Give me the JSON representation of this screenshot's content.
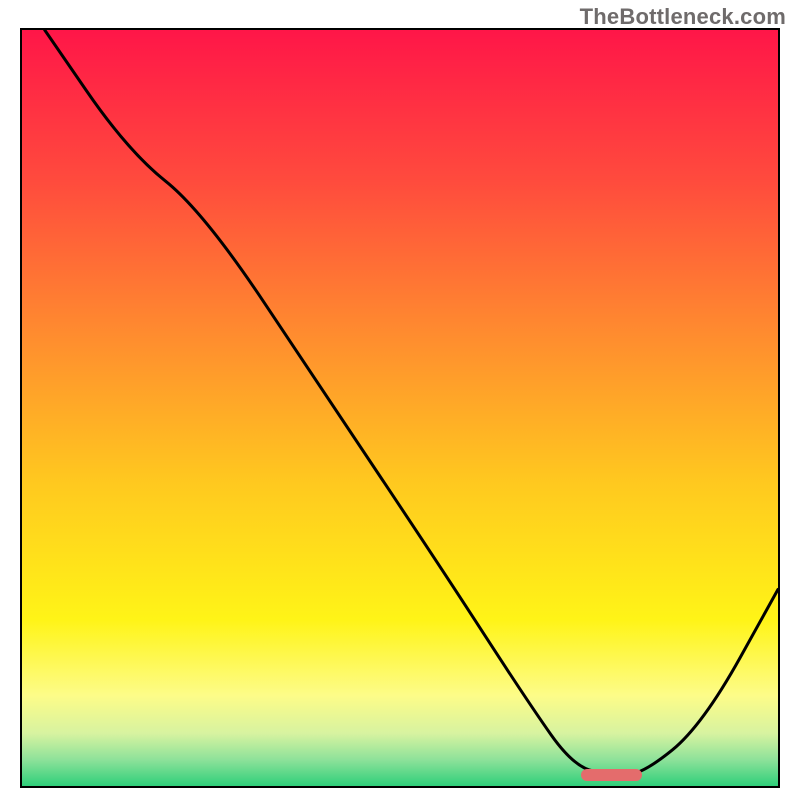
{
  "watermark": "TheBottleneck.com",
  "chart_data": {
    "type": "line",
    "title": "",
    "xlabel": "",
    "ylabel": "",
    "xlim": [
      0,
      100
    ],
    "ylim": [
      0,
      100
    ],
    "grid": false,
    "legend": false,
    "series": [
      {
        "name": "curve",
        "x": [
          3,
          14,
          24,
          40,
          56,
          67,
          73,
          78,
          82,
          90,
          100
        ],
        "y": [
          100,
          84,
          76,
          52,
          28,
          11,
          2.5,
          1.5,
          1.5,
          8,
          26
        ]
      }
    ],
    "marker": {
      "name": "optimal-range",
      "x_start": 74,
      "x_end": 82,
      "y": 1.5,
      "color": "#e46c6c"
    },
    "background_gradient": {
      "stops": [
        {
          "offset": 0.0,
          "color": "#ff1648"
        },
        {
          "offset": 0.2,
          "color": "#ff4b3d"
        },
        {
          "offset": 0.4,
          "color": "#ff8b2f"
        },
        {
          "offset": 0.6,
          "color": "#ffc91f"
        },
        {
          "offset": 0.78,
          "color": "#fff417"
        },
        {
          "offset": 0.88,
          "color": "#fdfc88"
        },
        {
          "offset": 0.93,
          "color": "#d8f3a0"
        },
        {
          "offset": 0.965,
          "color": "#8ee29a"
        },
        {
          "offset": 1.0,
          "color": "#2fcf7a"
        }
      ]
    }
  }
}
